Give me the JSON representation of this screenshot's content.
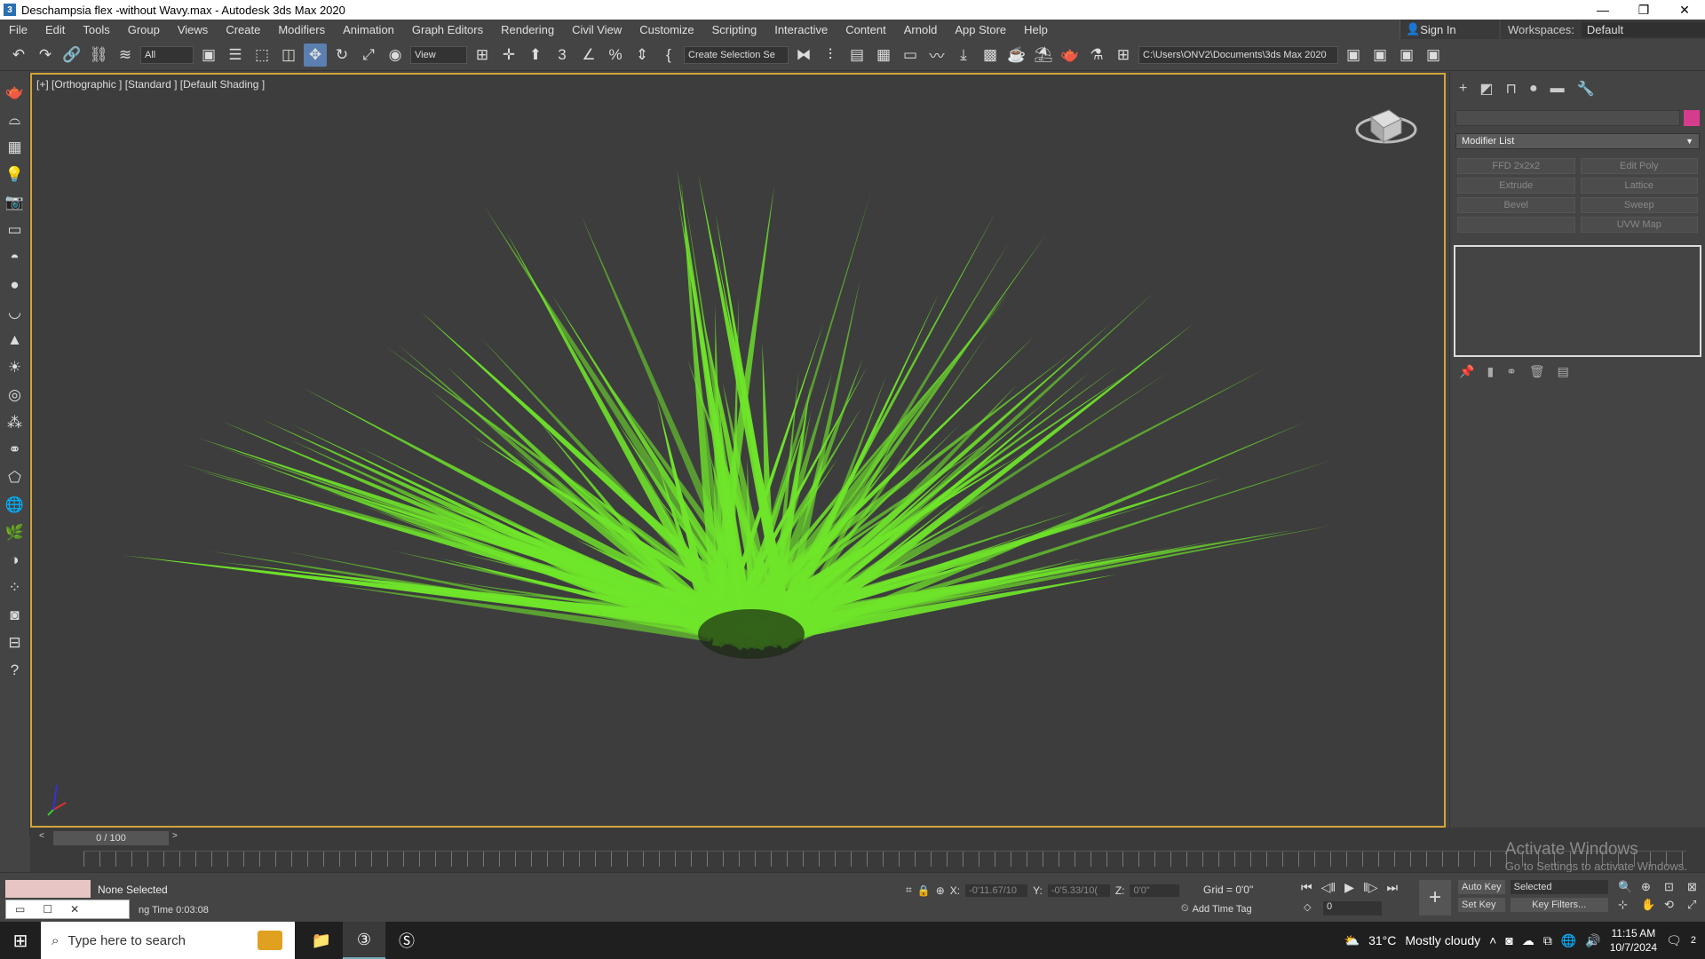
{
  "window": {
    "title": "Deschampsia flex -without Wavy.max - Autodesk 3ds Max 2020",
    "min": "—",
    "max": "❐",
    "close": "✕"
  },
  "menu": [
    "File",
    "Edit",
    "Tools",
    "Group",
    "Views",
    "Create",
    "Modifiers",
    "Animation",
    "Graph Editors",
    "Rendering",
    "Civil View",
    "Customize",
    "Scripting",
    "Interactive",
    "Content",
    "Arnold",
    "App Store",
    "Help"
  ],
  "account": {
    "sign_in": "Sign In",
    "workspaces_label": "Workspaces:",
    "workspace_value": "Default"
  },
  "toolbar": {
    "filter": "All",
    "ref_coord": "View",
    "selection_set": "Create Selection Se",
    "path": "C:\\Users\\ONV2\\Documents\\3ds Max 2020"
  },
  "viewport": {
    "label": "[+] [Orthographic ] [Standard ] [Default Shading ]",
    "plant_color": "#6fe52a"
  },
  "command_panel": {
    "modifier_list": "Modifier List",
    "modifier_buttons": [
      "FFD 2x2x2",
      "Edit Poly",
      "Extrude",
      "Lattice",
      "Bevel",
      "Sweep",
      "",
      "UVW Map"
    ],
    "accent": "#d63c8c"
  },
  "timeline": {
    "frame": "0 / 100"
  },
  "status": {
    "selection": "None Selected",
    "render_time": "ng Time  0:03:08",
    "x_label": "X:",
    "x": "-0'11.67/10",
    "y_label": "Y:",
    "y": "-0'5.33/10(",
    "z_label": "Z:",
    "z": "0'0\"",
    "grid": "Grid = 0'0\"",
    "add_time_tag": "Add Time Tag",
    "frame_value": "0",
    "auto_key": "Auto Key",
    "set_key": "Set Key",
    "key_mode": "Selected",
    "key_filters": "Key Filters..."
  },
  "watermark": {
    "line1": "Activate Windows",
    "line2": "Go to Settings to activate Windows."
  },
  "taskbar": {
    "search_placeholder": "Type here to search",
    "weather_temp": "31°C",
    "weather_text": "Mostly cloudy",
    "time": "11:15 AM",
    "date": "10/7/2024",
    "notif_count": "2"
  }
}
